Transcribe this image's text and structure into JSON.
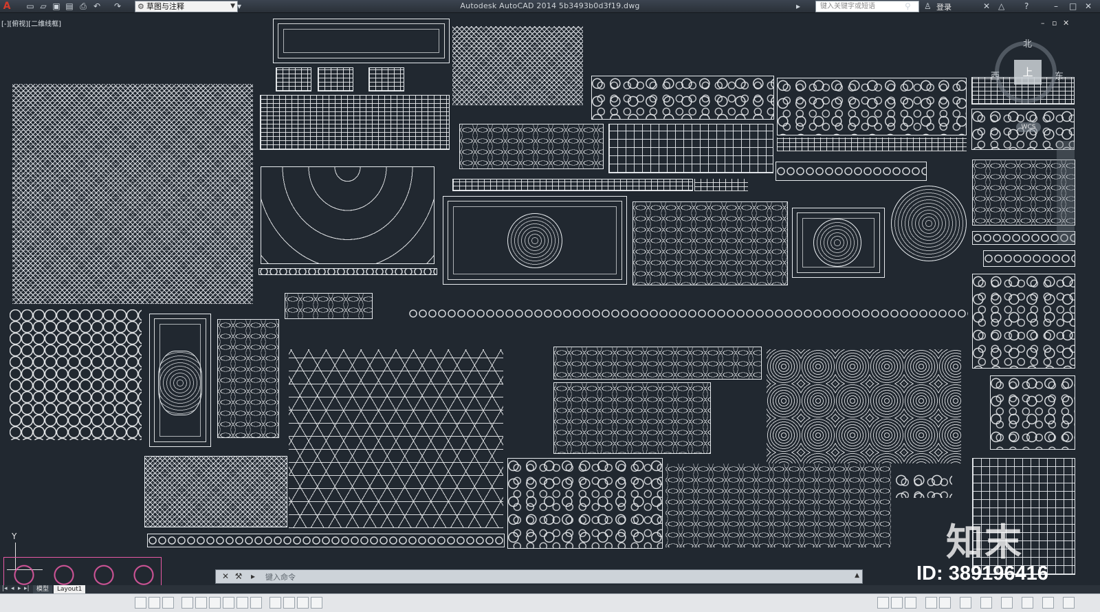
{
  "titlebar": {
    "app_icon": "A",
    "workspace": "草图与注释",
    "title": "Autodesk AutoCAD 2014    5b3493b0d3f19.dwg",
    "search_placeholder": "键入关键字或短语",
    "login": "登录"
  },
  "viewport": {
    "label": "[-][俯视][二维线框]"
  },
  "viewcube": {
    "north": "北",
    "west": "西",
    "east": "东",
    "top": "上",
    "wcs": "WCS"
  },
  "ucs": {
    "y_label": "Y"
  },
  "command": {
    "placeholder": "键入命令"
  },
  "tabs": {
    "model": "模型",
    "layout": "Layout1"
  },
  "watermark": {
    "logo": "知末",
    "id": "ID: 389196416"
  },
  "colors": {
    "canvas": "#212830",
    "linework": "#e8ecef",
    "highlight": "#e95aa6"
  }
}
